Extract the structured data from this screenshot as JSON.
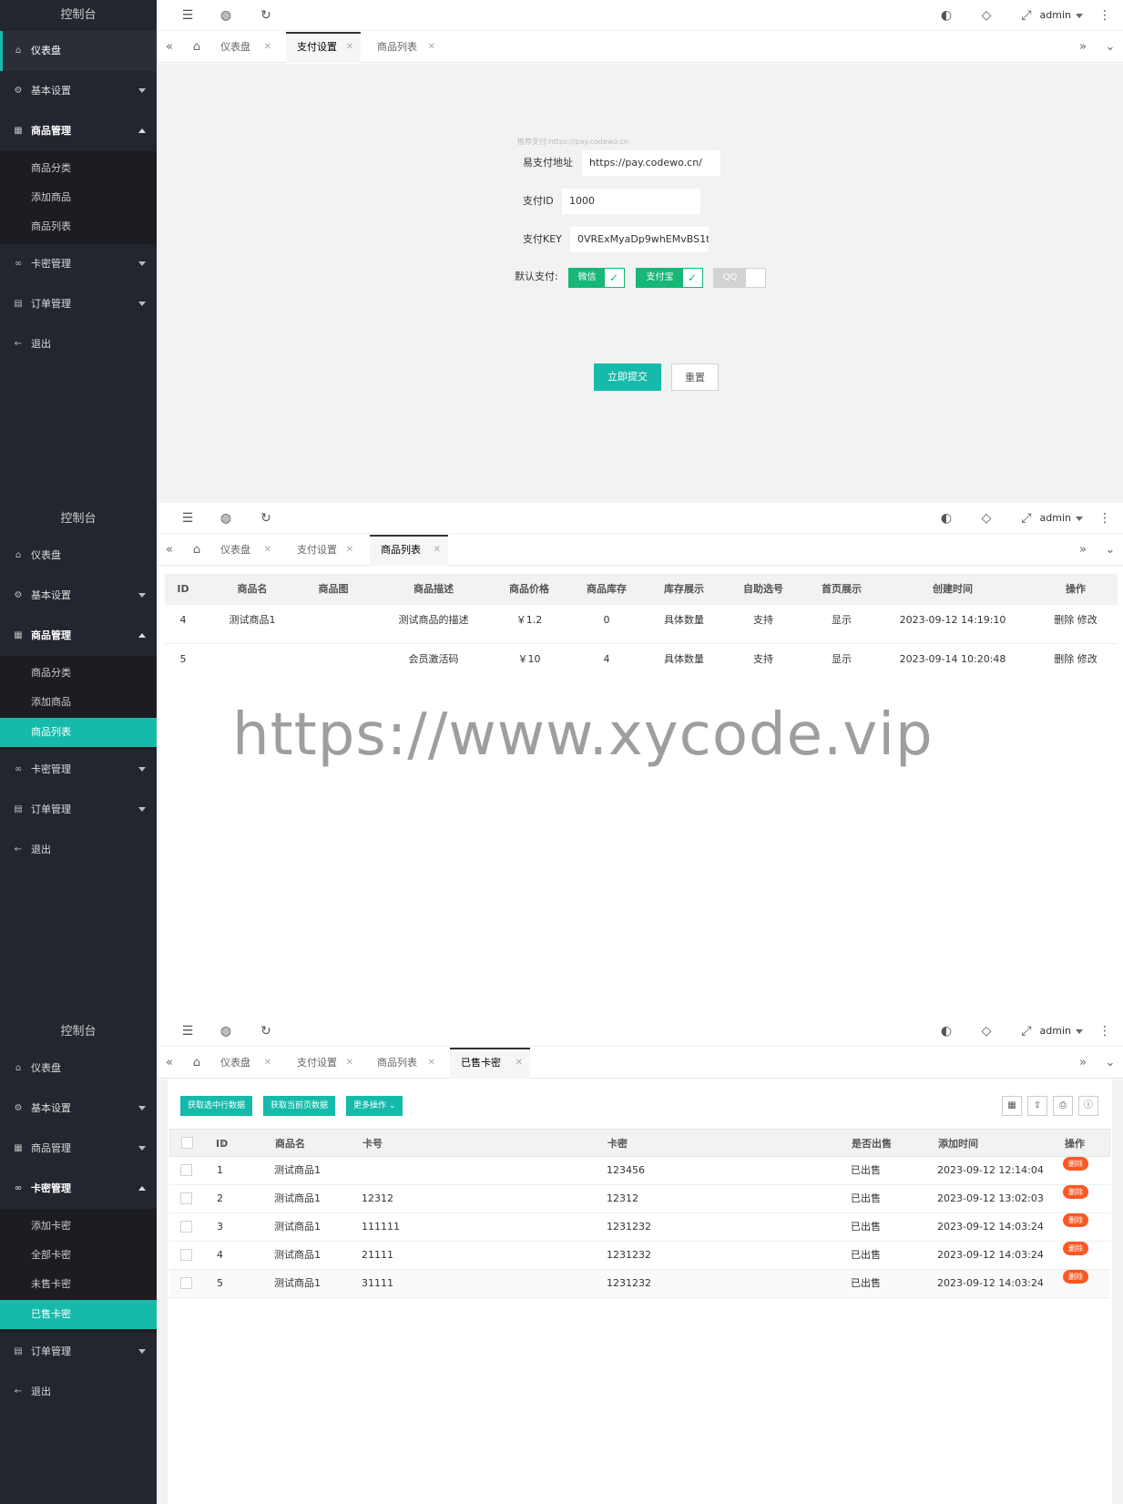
{
  "sidebar": {
    "logo": "控制台",
    "dashboard": "仪表盘",
    "basic_settings": "基本设置",
    "goods_mgmt": "商品管理",
    "goods_sub": [
      "商品分类",
      "添加商品",
      "商品列表"
    ],
    "card_mgmt": "卡密管理",
    "card_sub": [
      "添加卡密",
      "全部卡密",
      "未售卡密",
      "已售卡密"
    ],
    "order_mgmt": "订单管理",
    "logout": "退出"
  },
  "topbar": {
    "user": "admin"
  },
  "tabs": {
    "dashboard": "仪表盘",
    "pay_settings": "支付设置",
    "goods_list": "商品列表",
    "sold_cards": "已售卡密"
  },
  "pay_form": {
    "hint": "推荐支付:https://pay.codewo.cn",
    "epay_label": "易支付地址",
    "epay_value": "https://pay.codewo.cn/",
    "pay_id_label": "支付ID",
    "pay_id_value": "1000",
    "pay_key_label": "支付KEY",
    "pay_key_value": "0VRExMyaDp9whEMvBS1t",
    "default_pay_label": "默认支付:",
    "wechat": "微信",
    "alipay": "支付宝",
    "qq": "QQ",
    "submit": "立即提交",
    "reset": "重置"
  },
  "goods_table": {
    "headers": [
      "ID",
      "商品名",
      "商品图",
      "商品描述",
      "商品价格",
      "商品库存",
      "库存展示",
      "自助选号",
      "首页展示",
      "创建时间",
      "操作"
    ],
    "rows": [
      [
        "4",
        "测试商品1",
        "",
        "测试商品的描述",
        "￥1.2",
        "0",
        "具体数量",
        "支持",
        "显示",
        "2023-09-12 14:19:10",
        "删除 修改"
      ],
      [
        "5",
        "",
        "",
        "会员激活码",
        "￥10",
        "4",
        "具体数量",
        "支持",
        "显示",
        "2023-09-14 10:20:48",
        "删除 修改"
      ]
    ]
  },
  "watermark": "https://www.xycode.vip",
  "cards_toolbar": {
    "get_selected": "获取选中行数据",
    "get_page": "获取当前页数据",
    "more": "更多操作"
  },
  "cards_table": {
    "headers": [
      "ID",
      "商品名",
      "卡号",
      "卡密",
      "是否出售",
      "添加时间",
      "操作"
    ],
    "rows": [
      [
        "1",
        "测试商品1",
        "",
        "123456",
        "已出售",
        "2023-09-12 12:14:04",
        "删除"
      ],
      [
        "2",
        "测试商品1",
        "12312",
        "12312",
        "已出售",
        "2023-09-12 13:02:03",
        "删除"
      ],
      [
        "3",
        "测试商品1",
        "111111",
        "1231232",
        "已出售",
        "2023-09-12 14:03:24",
        "删除"
      ],
      [
        "4",
        "测试商品1",
        "21111",
        "1231232",
        "已出售",
        "2023-09-12 14:03:24",
        "删除"
      ],
      [
        "5",
        "测试商品1",
        "31111",
        "1231232",
        "已出售",
        "2023-09-12 14:03:24",
        "删除"
      ]
    ]
  },
  "colors": {
    "accent": "#16baaa",
    "switch_on": "#16b777",
    "danger": "#ff5722",
    "sidebar_bg": "#23262e"
  }
}
